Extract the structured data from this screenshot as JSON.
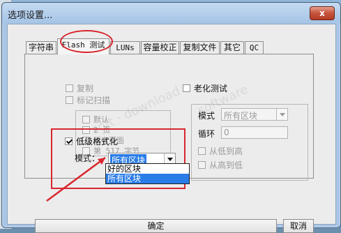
{
  "window": {
    "title": "选项设置...",
    "close_label": "x"
  },
  "tabs": [
    {
      "label": "字符串"
    },
    {
      "label": "Flash 测试"
    },
    {
      "label": "LUNs"
    },
    {
      "label": "容量校正"
    },
    {
      "label": "复制文件"
    },
    {
      "label": "其它"
    },
    {
      "label": "QC"
    }
  ],
  "left_options": {
    "copy": "复制",
    "mark_scan": "标记扫描",
    "default": "默认",
    "two_pages": "2 页",
    "all_pages": "所有页面",
    "byte_517": "第 517 字节"
  },
  "aging": {
    "title": "老化测试",
    "mode_label": "模式",
    "mode_value": "所有区块",
    "loop_label": "循环",
    "loop_value": "0",
    "low_to_high": "从低到高",
    "high_to_low": "从高到低"
  },
  "format": {
    "title": "低级格式化",
    "mode_label": "模式：",
    "selected_value": "所有区块",
    "options": [
      "好的区块",
      "所有区块"
    ]
  },
  "buttons": {
    "ok": "确定",
    "cancel": "取消"
  },
  "colors": {
    "annotation_red": "#d9262e",
    "selection_blue": "#2a7ce7",
    "window_blue": "#a9c6e7"
  }
}
